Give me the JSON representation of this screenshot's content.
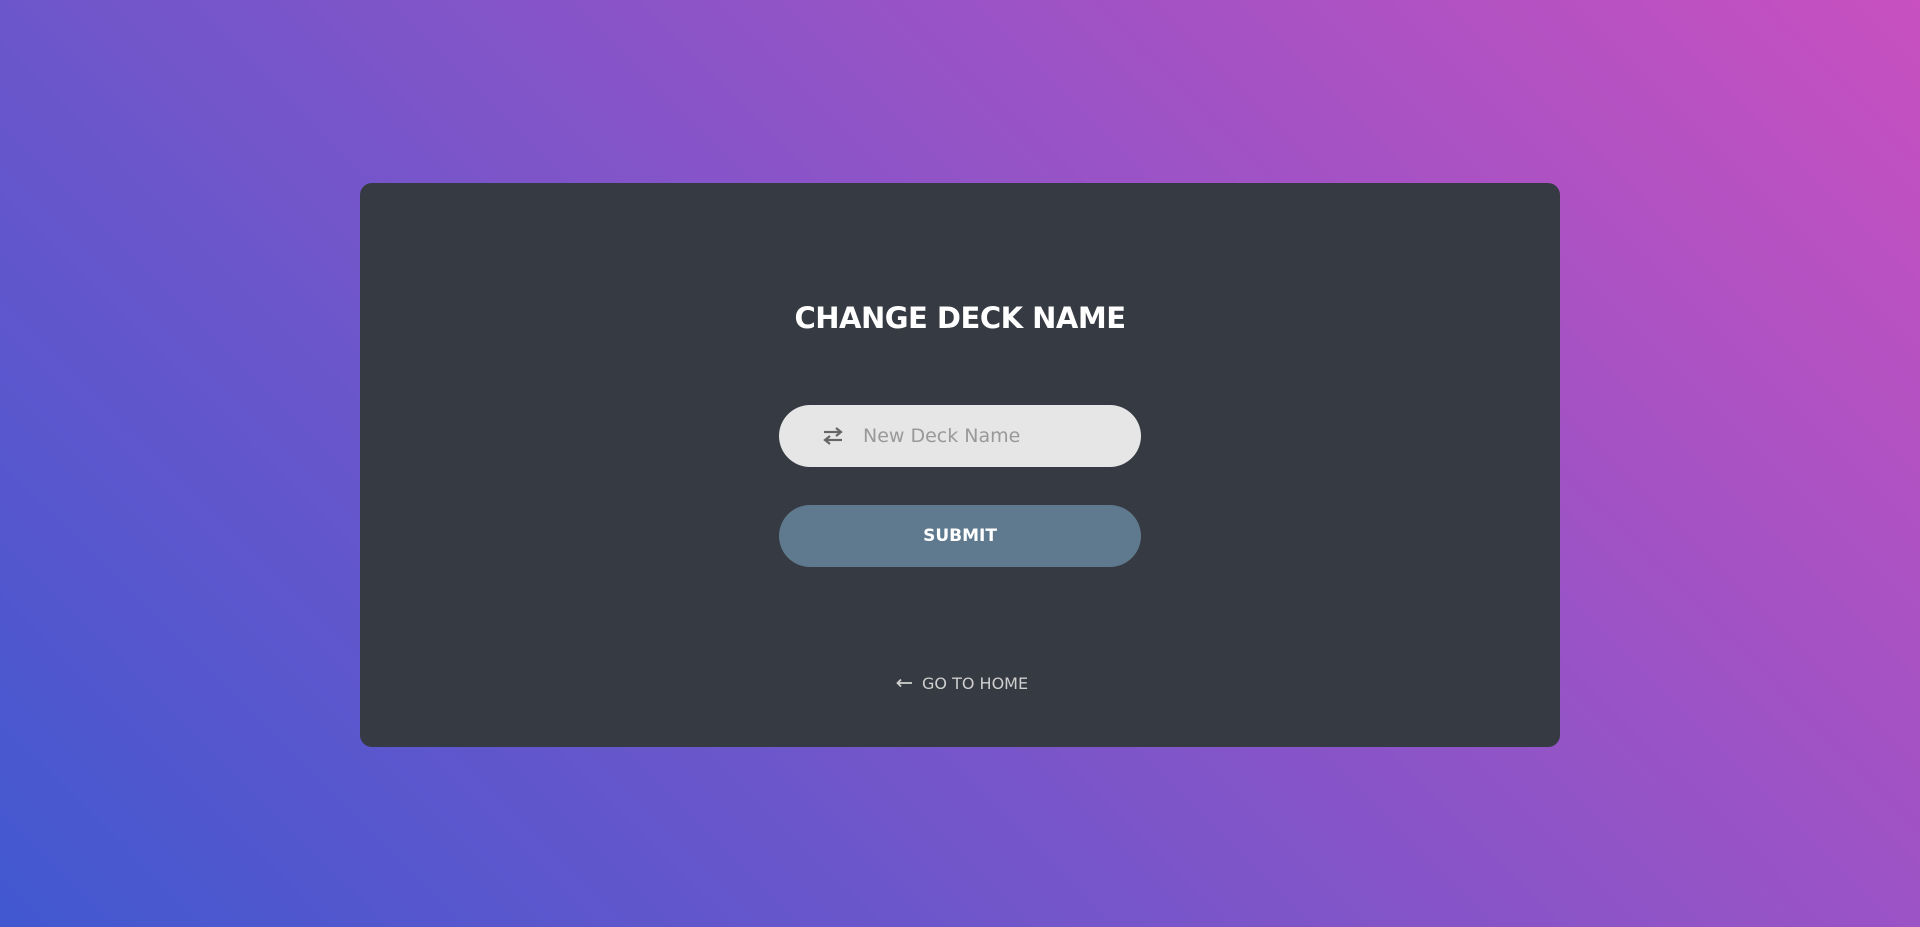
{
  "form": {
    "title": "CHANGE DECK NAME",
    "input": {
      "icon": "swap-arrows-icon",
      "placeholder": "New Deck Name",
      "value": ""
    },
    "submit_label": "SUBMIT"
  },
  "footer": {
    "home_link_icon": "arrow-left-icon",
    "home_link_label": "GO TO HOME"
  },
  "colors": {
    "background_gradient_start": "#4158d0",
    "background_gradient_end": "#c850c0",
    "card": "#363a42",
    "input_bg": "#e6e6e6",
    "submit_bg": "#5f7a8e",
    "title_text": "#ffffff",
    "link_text": "#cfcfcf"
  }
}
